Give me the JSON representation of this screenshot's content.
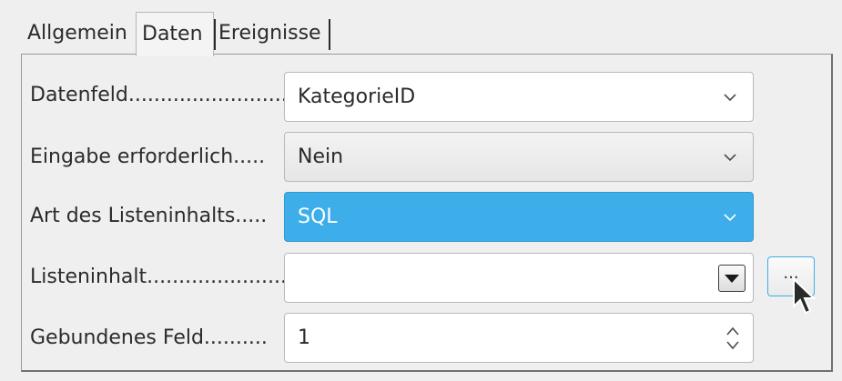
{
  "tabs": [
    {
      "label": "Allgemein"
    },
    {
      "label": "Daten"
    },
    {
      "label": "Ereignisse"
    }
  ],
  "fields": {
    "datenfeld": {
      "label": "Datenfeld..........................",
      "value": "KategorieID"
    },
    "eingabe": {
      "label": "Eingabe erforderlich.....",
      "value": "Nein"
    },
    "art": {
      "label": "Art des Listeninhalts.....",
      "value": "SQL"
    },
    "listeninhalt": {
      "label": "Listeninhalt......................",
      "value": ""
    },
    "gebunden": {
      "label": "Gebundenes Feld..........",
      "value": "1"
    }
  },
  "browse_button": {
    "label": "..."
  },
  "colors": {
    "accent": "#3daee9",
    "background": "#efefef"
  },
  "icons": [
    "chevron-down-icon",
    "dropdown-triangle-icon",
    "spin-updown-icon",
    "mouse-pointer-icon"
  ]
}
